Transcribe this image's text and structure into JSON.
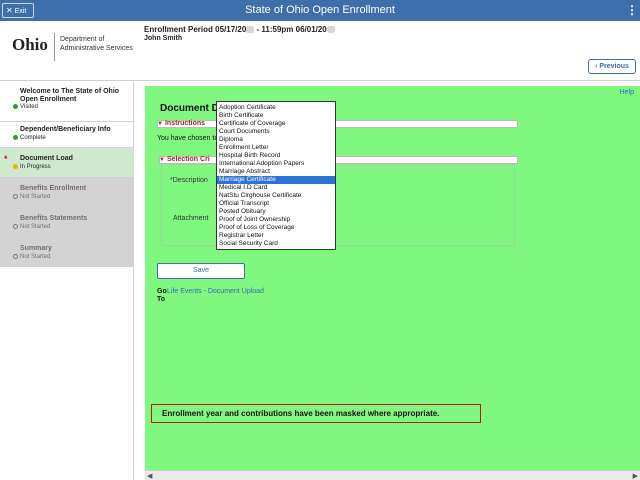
{
  "topbar": {
    "exit_label": "Exit",
    "title": "State of Ohio Open Enrollment"
  },
  "header": {
    "logo_word": "Ohio",
    "logo_dept_line1": "Department of",
    "logo_dept_line2": "Administrative Services",
    "enrollment_period": "Enrollment Period 05/17/20",
    "enrollment_period_mid": " - 11:59pm 06/01/20",
    "user_name": "John Smith",
    "previous_label": "Previous"
  },
  "sidebar": {
    "steps": [
      {
        "title": "Welcome to The State of Ohio Open Enrollment",
        "status": "Visited"
      },
      {
        "title": "Dependent/Beneficiary Info",
        "status": "Complete"
      },
      {
        "title": "Document Load",
        "status": "In Progress"
      },
      {
        "title": "Benefits Enrollment",
        "status": "Not Started"
      },
      {
        "title": "Benefits Statements",
        "status": "Not Started"
      },
      {
        "title": "Summary",
        "status": "Not Started"
      }
    ]
  },
  "main": {
    "help": "Help",
    "heading": "Document D",
    "instructions_label": "Instructions",
    "you_chosen": "You have chosen to",
    "criteria_label": "Selection Cri",
    "description_label": "*Description",
    "attachment_label": "Attachment",
    "save_label": "Save",
    "goto_label": "Go To",
    "goto_link": "Life Events - Document Upload",
    "note": "Enrollment year and contributions have been masked where appropriate."
  },
  "dropdown": {
    "selected": "Marriage Certificate",
    "options": [
      "Adoption Certificate",
      "Birth Certificate",
      "Certificate of Coverage",
      "Court Documents",
      "Diploma",
      "Enrollment Letter",
      "Hospital Birth Record",
      "International Adoption Papers",
      "Marriage Abstract",
      "Marriage Certificate",
      "Medical I.D Card",
      "NatStu Clrghouse Certificate",
      "Official Transcript",
      "Posted Obituary",
      "Proof of Joint Ownership",
      "Proof of Loss of Coverage",
      "Registrar Letter",
      "Social Security Card"
    ]
  },
  "colors": {
    "topbar": "#3f6fab",
    "main_bg": "#80f880",
    "accent_red": "#c0171e",
    "selected_blue": "#2a74d6"
  }
}
